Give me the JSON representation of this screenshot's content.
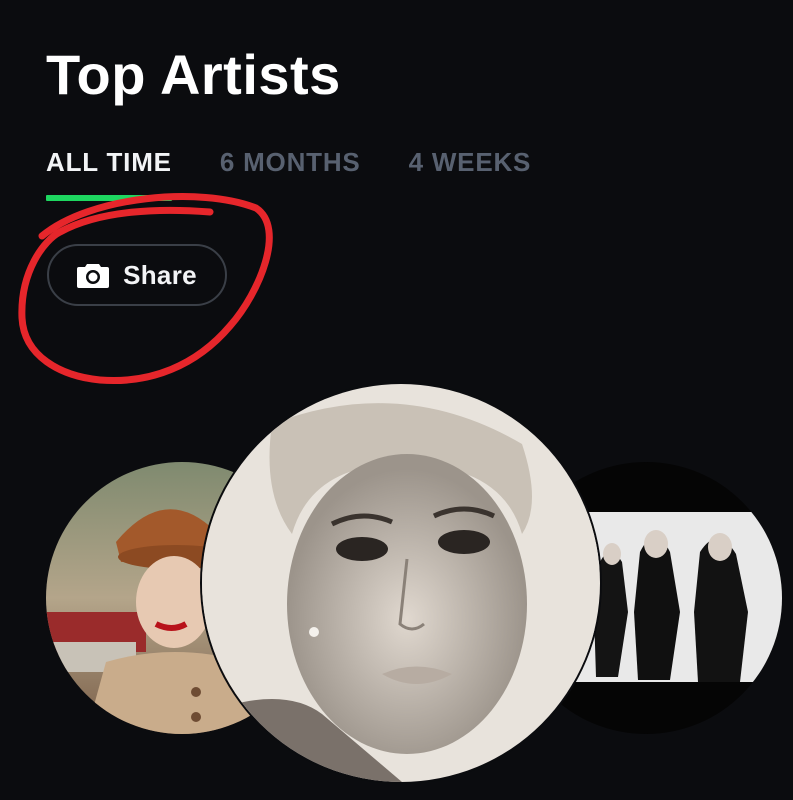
{
  "page": {
    "title": "Top Artists"
  },
  "tabs": [
    {
      "label": "ALL TIME",
      "active": true
    },
    {
      "label": "6 MONTHS",
      "active": false
    },
    {
      "label": "4 WEEKS",
      "active": false
    }
  ],
  "share_button": {
    "label": "Share",
    "icon": "camera-icon"
  },
  "colors": {
    "background": "#0b0c0f",
    "tab_active_underline": "#1ed760",
    "tab_inactive_text": "#586170",
    "annotation": "#e6262b"
  },
  "artists": [
    {
      "position": "left",
      "image": "artist-photo-red-hat"
    },
    {
      "position": "center",
      "image": "artist-photo-monochrome-portrait"
    },
    {
      "position": "right",
      "image": "artist-photo-band-group"
    }
  ]
}
